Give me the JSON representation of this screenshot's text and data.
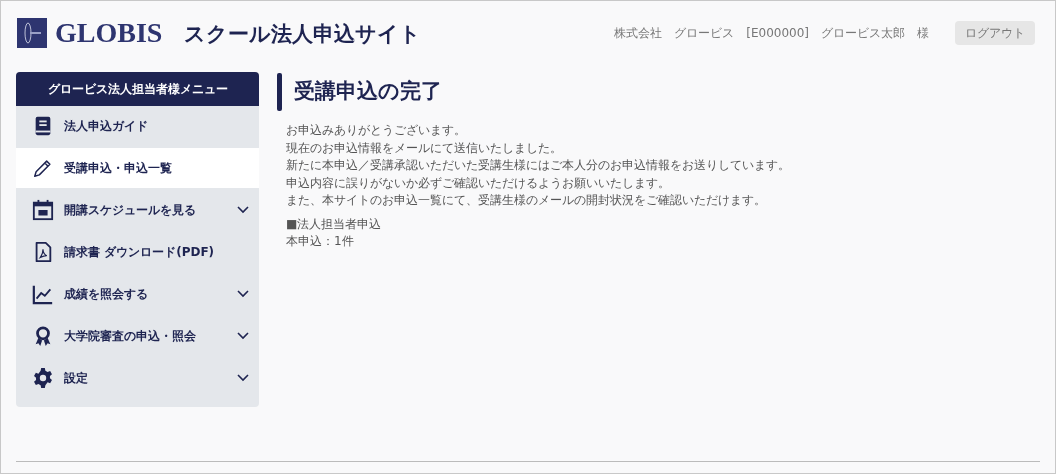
{
  "header": {
    "brand": "GLOBIS",
    "site_title": "スクール法人申込サイト",
    "user_info": "株式会社　グロービス　[E000000]　グロービス太郎　様",
    "logout_button": "ログアウト"
  },
  "sidebar": {
    "title": "グロービス法人担当者様メニュー",
    "items": [
      {
        "label": "法人申込ガイド",
        "selected": false,
        "expandable": false
      },
      {
        "label": "受講申込・申込一覧",
        "selected": true,
        "expandable": false
      },
      {
        "label": "開講スケジュールを見る",
        "selected": false,
        "expandable": true
      },
      {
        "label": "請求書 ダウンロード(PDF)",
        "selected": false,
        "expandable": false
      },
      {
        "label": "成績を照会する",
        "selected": false,
        "expandable": true
      },
      {
        "label": "大学院審査の申込・照会",
        "selected": false,
        "expandable": true
      },
      {
        "label": "設定",
        "selected": false,
        "expandable": true
      }
    ]
  },
  "main": {
    "heading": "受講申込の完了",
    "paragraphs": [
      "お申込みありがとうございます。",
      "現在のお申込情報をメールにて送信いたしました。",
      "新たに本申込／受講承認いただいた受講生様にはご本人分のお申込情報をお送りしています。",
      "申込内容に誤りがないか必ずご確認いただけるようお願いいたします。",
      "また、本サイトのお申込一覧にて、受講生様のメールの開封状況をご確認いただけます。"
    ],
    "summary": [
      "■法人担当者申込",
      "本申込：1件"
    ]
  }
}
